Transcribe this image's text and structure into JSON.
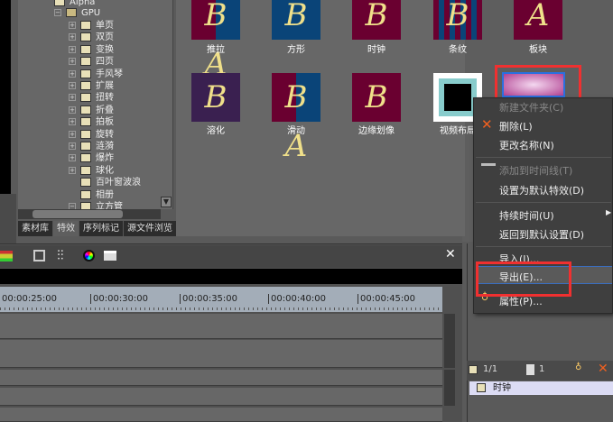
{
  "tree": {
    "items": [
      {
        "label": "Alpha",
        "type": "file"
      },
      {
        "label": "GPU",
        "type": "folder"
      },
      {
        "label": "单页"
      },
      {
        "label": "双页"
      },
      {
        "label": "变换"
      },
      {
        "label": "四页"
      },
      {
        "label": "手风琴"
      },
      {
        "label": "扩展"
      },
      {
        "label": "扭转"
      },
      {
        "label": "折叠"
      },
      {
        "label": "拍板"
      },
      {
        "label": "旋转"
      },
      {
        "label": "涟漪"
      },
      {
        "label": "爆炸"
      },
      {
        "label": "球化"
      },
      {
        "label": "百叶窗波浪"
      },
      {
        "label": "相册"
      },
      {
        "label": "立方管"
      }
    ]
  },
  "tabs": [
    "素材库",
    "特效",
    "序列标记",
    "源文件浏览"
  ],
  "thumbs": [
    {
      "label": "推拉"
    },
    {
      "label": "方形"
    },
    {
      "label": "时钟"
    },
    {
      "label": "条纹"
    },
    {
      "label": "板块"
    },
    {
      "label": "溶化"
    },
    {
      "label": "滑动"
    },
    {
      "label": "边缘划像"
    },
    {
      "label": "视频布局"
    }
  ],
  "menu": {
    "new_folder": "新建文件夹(C)",
    "delete": "删除(L)",
    "rename": "更改名称(N)",
    "add_timeline": "添加到时间线(T)",
    "set_default": "设置为默认特效(D)",
    "duration": "持续时间(U)",
    "reset_default": "返回到默认设置(D)",
    "import": "导入(I)...",
    "export": "导出(E)...",
    "properties": "属性(P)..."
  },
  "ruler": [
    "00:00:25:00",
    "00:00:30:00",
    "00:00:35:00",
    "00:00:40:00",
    "00:00:45:00"
  ],
  "right_panel": {
    "page": "1/1",
    "count": "1",
    "item": "时钟"
  },
  "colors": {
    "highlight": "#f03030",
    "accent": "#3a6ec0"
  }
}
